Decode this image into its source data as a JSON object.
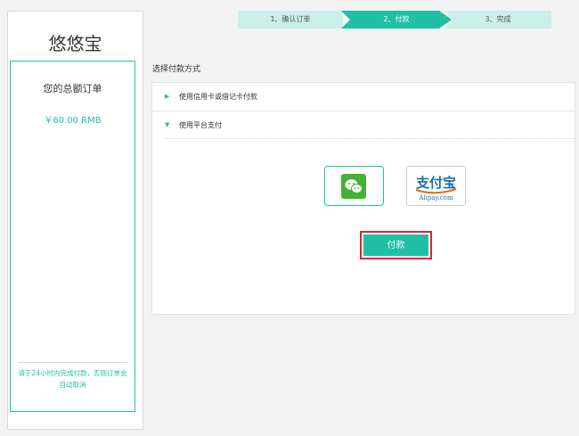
{
  "sidebar": {
    "brand": "悠悠宝",
    "order_title": "您的总额订单",
    "order_amount": "￥60.00  RMB",
    "note": "请于24小时内完成付款，否则订单会自动取消"
  },
  "steps": [
    {
      "label": "1、确认订单",
      "state": "done"
    },
    {
      "label": "2、付款",
      "state": "active"
    },
    {
      "label": "3、完成",
      "state": "pending"
    }
  ],
  "main": {
    "section_title": "选择付款方式",
    "options": [
      {
        "label": "使用信用卡或借记卡付款",
        "expanded": false
      },
      {
        "label": "使用平台支付",
        "expanded": true
      }
    ],
    "methods": [
      {
        "name": "wechat-pay",
        "icon": "wechat-icon",
        "selected": true
      },
      {
        "name": "alipay",
        "logo_text": "支付宝",
        "logo_sub": "Alipay.com",
        "selected": false
      }
    ],
    "pay_button": "付款"
  },
  "colors": {
    "accent": "#1fc0a6",
    "accent_light": "#c9efe8",
    "highlight": "#e0242b",
    "wechat_green": "#43b133",
    "alipay_blue": "#1a6fb5",
    "alipay_orange": "#e36b1b"
  }
}
